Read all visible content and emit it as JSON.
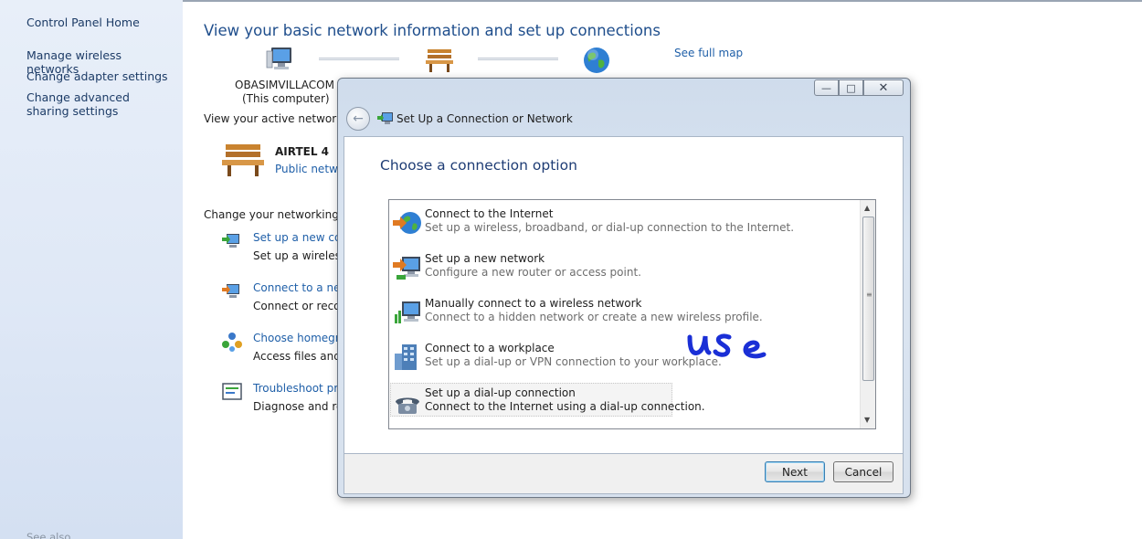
{
  "sidebar": {
    "home": "Control Panel Home",
    "items": [
      {
        "label": "Manage wireless networks"
      },
      {
        "label": "Change adapter settings"
      },
      {
        "label": "Change advanced sharing settings"
      }
    ],
    "see_also": "See also"
  },
  "main": {
    "title": "View your basic network information and set up connections",
    "see_full_map": "See full map",
    "computer_name": "OBASIMVILLACOM",
    "computer_sub": "(This computer)",
    "active_networks_label": "View your active networks",
    "network_name": "AIRTEL  4",
    "network_type": "Public netwo",
    "change_settings_label": "Change your networking set",
    "tasks": [
      {
        "link": "Set up a new conn",
        "desc": "Set up a wireless,"
      },
      {
        "link": "Connect to a netw",
        "desc": "Connect or recon"
      },
      {
        "link": "Choose homegro",
        "desc": "Access files and p"
      },
      {
        "link": "Troubleshoot pro",
        "desc": "Diagnose and rep"
      }
    ]
  },
  "dialog": {
    "title": "Set Up a Connection or Network",
    "heading": "Choose a connection option",
    "options": [
      {
        "title": "Connect to the Internet",
        "desc": "Set up a wireless, broadband, or dial-up connection to the Internet.",
        "icon": "globe-icon"
      },
      {
        "title": "Set up a new network",
        "desc": "Configure a new router or access point.",
        "icon": "new-network-icon"
      },
      {
        "title": "Manually connect to a wireless network",
        "desc": "Connect to a hidden network or create a new wireless profile.",
        "icon": "wireless-network-icon"
      },
      {
        "title": "Connect to a workplace",
        "desc": "Set up a dial-up or VPN connection to your workplace.",
        "icon": "workplace-icon"
      },
      {
        "title": "Set up a dial-up connection",
        "desc": "Connect to the Internet using a dial-up connection.",
        "icon": "phone-icon"
      }
    ],
    "selected_index": 4,
    "annotation": "use",
    "next_label": "Next",
    "cancel_label": "Cancel"
  },
  "colors": {
    "link": "#1f5fa8",
    "heading": "#1f4e8c",
    "annotation_ink": "#1a2fd6"
  }
}
